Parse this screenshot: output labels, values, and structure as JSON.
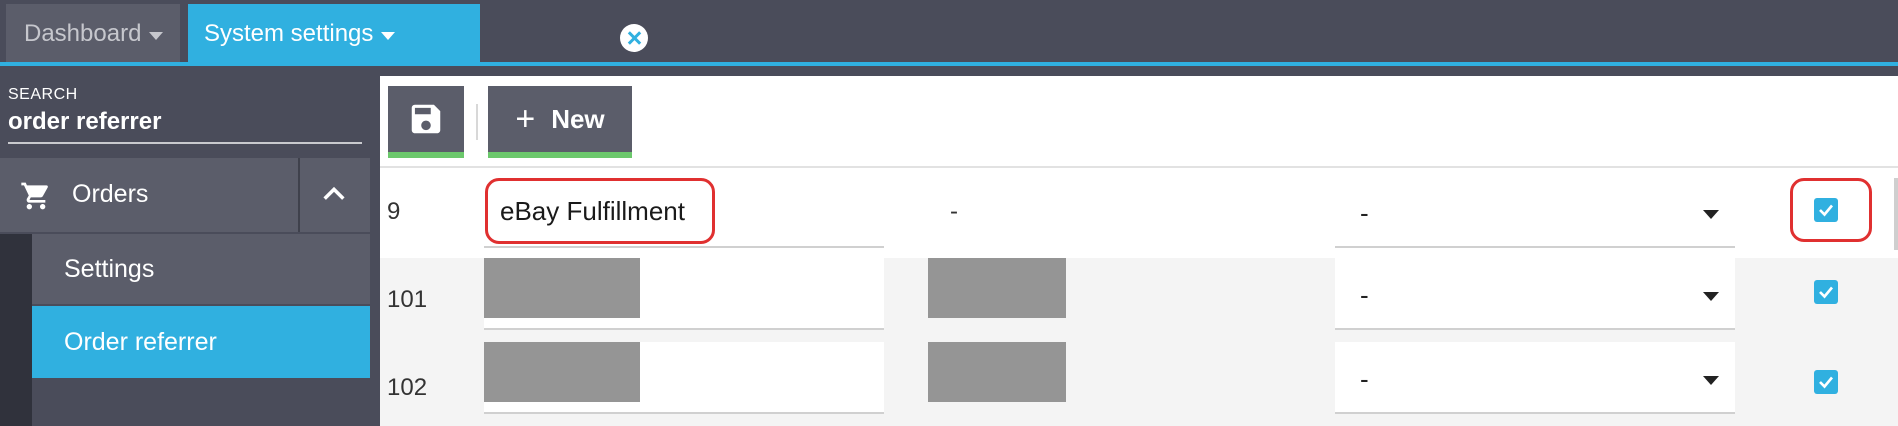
{
  "tabs": [
    {
      "label": "Dashboard",
      "active": false
    },
    {
      "label": "System settings",
      "active": true
    }
  ],
  "colors": {
    "accent": "#30b0e0",
    "panel": "#5b5d6a",
    "dark": "#4a4c5a",
    "green": "#6cc86c",
    "annotation": "#e03030"
  },
  "sidebar": {
    "search_label": "SEARCH",
    "search_value": "order referrer",
    "group": {
      "label": "Orders",
      "icon": "cart-icon",
      "expand_icon": "chevron-up-icon"
    },
    "items": [
      {
        "label": "Settings",
        "active": false
      },
      {
        "label": "Order referrer",
        "active": true
      }
    ]
  },
  "toolbar": {
    "save_icon": "floppy-disk-icon",
    "new_label": "New"
  },
  "rows": [
    {
      "id": "9",
      "name": "eBay Fulfillment",
      "code": "-",
      "select": "-",
      "checked": true
    },
    {
      "id": "101",
      "name": "",
      "code": "",
      "select": "-",
      "checked": true
    },
    {
      "id": "102",
      "name": "",
      "code": "",
      "select": "-",
      "checked": true
    }
  ]
}
